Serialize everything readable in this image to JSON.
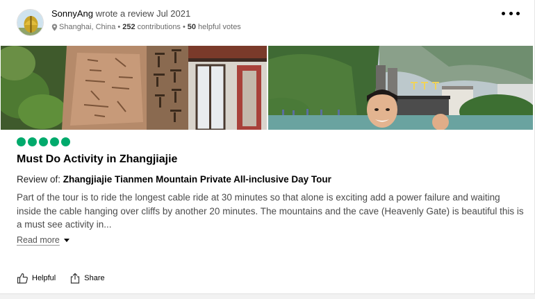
{
  "reviewer": {
    "name": "SonnyAng",
    "action_text": "wrote a review",
    "date": "Jul 2021",
    "location": "Shanghai, China",
    "contributions_count": "252",
    "contributions_label": "contributions",
    "helpful_count": "50",
    "helpful_label": "helpful votes",
    "separator": "•"
  },
  "review": {
    "rating": 5,
    "title": "Must Do Activity in Zhangjiajie",
    "review_of_label": "Review of:",
    "review_of_name": "Zhangjiajie Tianmen Mountain Private All-inclusive Day Tour",
    "text": "Part of the tour is to ride the longest cable ride at 30 minutes so that alone is exciting add a power failure and waiting inside the cable hanging over cliffs by another 20 minutes. The mountains and the cave (Heavenly Gate) is beautiful this is a must see activity in...",
    "read_more": "Read more"
  },
  "photos": [
    {
      "name": "stone-carving-temple-photo"
    },
    {
      "name": "tianmen-mountain-selfie-photo"
    }
  ],
  "actions": {
    "helpful": "Helpful",
    "share": "Share"
  },
  "colors": {
    "rating_bubble": "#00aa6c",
    "body_text": "#4a4a4a"
  },
  "icons": [
    "location-pin-icon",
    "more-options-icon",
    "thumbs-up-icon",
    "share-icon",
    "chevron-down-icon"
  ]
}
